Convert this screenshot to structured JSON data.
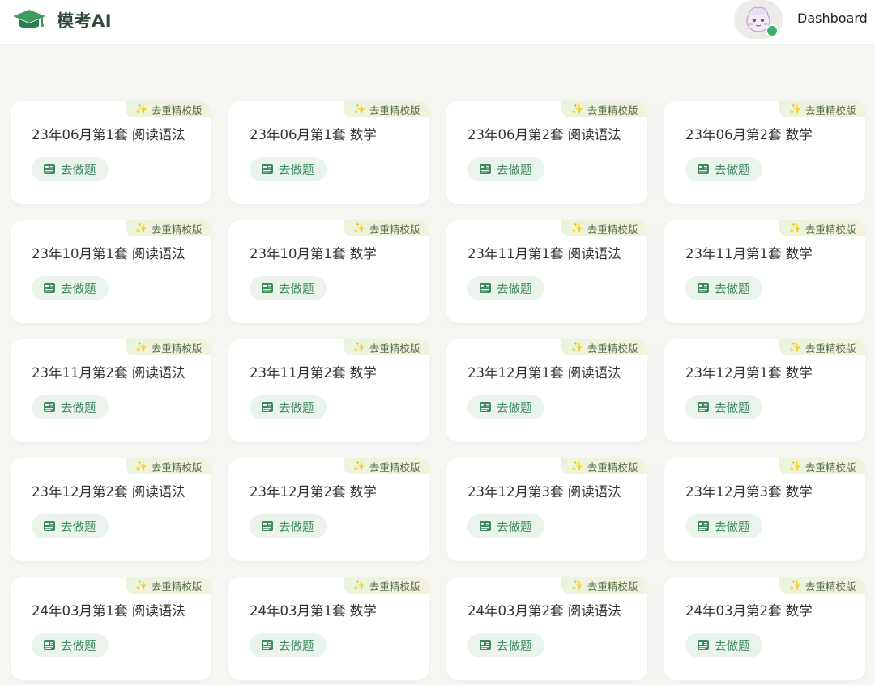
{
  "header": {
    "brand": "模考AI",
    "logo_icon": "graduation-cap-icon",
    "avatar_icon": "cartoon-avatar-icon",
    "dashboard_label": "Dashboard",
    "accent_color": "#3fb06b"
  },
  "badge_label": "去重精校版",
  "action_label": "去做题",
  "cards": [
    {
      "title": "23年06月第1套 阅读语法"
    },
    {
      "title": "23年06月第1套 数学"
    },
    {
      "title": "23年06月第2套 阅读语法"
    },
    {
      "title": "23年06月第2套 数学"
    },
    {
      "title": "23年10月第1套 阅读语法"
    },
    {
      "title": "23年10月第1套 数学"
    },
    {
      "title": "23年11月第1套 阅读语法"
    },
    {
      "title": "23年11月第1套 数学"
    },
    {
      "title": "23年11月第2套 阅读语法"
    },
    {
      "title": "23年11月第2套 数学"
    },
    {
      "title": "23年12月第1套 阅读语法"
    },
    {
      "title": "23年12月第1套 数学"
    },
    {
      "title": "23年12月第2套 阅读语法"
    },
    {
      "title": "23年12月第2套 数学"
    },
    {
      "title": "23年12月第3套 阅读语法"
    },
    {
      "title": "23年12月第3套 数学"
    },
    {
      "title": "24年03月第1套 阅读语法"
    },
    {
      "title": "24年03月第1套 数学"
    },
    {
      "title": "24年03月第2套 阅读语法"
    },
    {
      "title": "24年03月第2套 数学"
    }
  ]
}
